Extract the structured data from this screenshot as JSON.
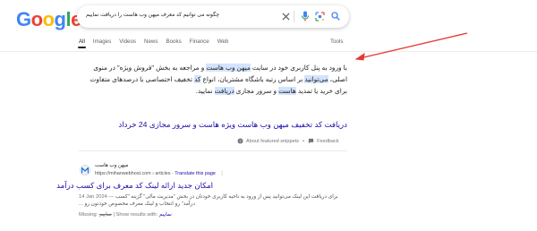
{
  "logo": {
    "letters": [
      "G",
      "o",
      "o",
      "g",
      "l",
      "e"
    ],
    "colors": [
      "#4285f4",
      "#ea4335",
      "#fbbc05",
      "#4285f4",
      "#34a853",
      "#ea4335"
    ]
  },
  "search": {
    "query": "چگونه می توانیم کد معرف میهن وب هاست را دریافت نماییم",
    "icons": [
      "close-icon",
      "mic-icon",
      "lens-icon",
      "search-icon"
    ]
  },
  "tabs": {
    "items": [
      "All",
      "Images",
      "Videos",
      "News",
      "Books",
      "Finance",
      "Web"
    ],
    "active": "All",
    "tools": "Tools"
  },
  "snippet": {
    "parts": [
      {
        "t": "با ورود به پنل کاربری خود در سایت ",
        "h": false
      },
      {
        "t": "میهن وب هاست",
        "h": true
      },
      {
        "t": " و مراجعه به بخش \"فروش ویژه\" در منوی اصلی، ",
        "h": false
      },
      {
        "t": "می‌توانید",
        "h": true
      },
      {
        "t": " بر اساس رتبه باشگاه مشتریان، انواع ",
        "h": false
      },
      {
        "t": "کد",
        "h": true
      },
      {
        "t": " تخفیف اختصاصی با درصدهای متفاوت برای خرید یا تمدید ",
        "h": false
      },
      {
        "t": "هاست",
        "h": true
      },
      {
        "t": " و سرور مجازی ",
        "h": false
      },
      {
        "t": "دریافت",
        "h": true
      },
      {
        "t": " نمایید.",
        "h": false
      }
    ]
  },
  "featured_link": "دریافت کد تخفیف میهن وب هاست ویژه هاست و سرور مجازی 24 خرداد",
  "about": {
    "label": "About featured snippets",
    "sep": "•",
    "feedback": "Feedback"
  },
  "result": {
    "site_name": "میهن وب هاست",
    "url": "https://mihanwebhost.com › articles",
    "url_sep": " · ",
    "translate": "Translate this page",
    "title": "امکان جدید ارائه لینک کد معرف برای کسب درآمد",
    "date": "14 Jan 2024",
    "date_sep": " — ",
    "desc": "برای دریافت این لینک می‌توانید پس از ورود به ناحیه کاربری خودتان در بخش \"مدیریت مالی\" گزینه \"کسب درآمد\" رو انتخاب و لینک معرف مخصوص خودتون رو ...",
    "missing_label": "Missing: ",
    "missing_word": "نماییم",
    "show_label": " | Show results with: ",
    "show_word": "نماییم"
  },
  "annotation": {
    "arrow_color": "#e53935"
  }
}
